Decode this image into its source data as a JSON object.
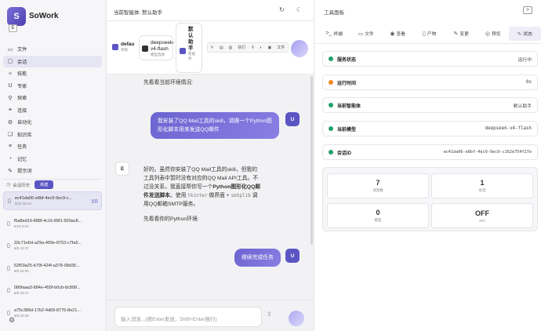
{
  "app": {
    "logo": "S",
    "name": "SoWork",
    "collapse_icon": "E"
  },
  "nav": [
    {
      "icon": "folder-icon",
      "glyph": "▭",
      "label": "文件"
    },
    {
      "icon": "chat-icon",
      "glyph": "▢",
      "label": "会话",
      "active": true
    },
    {
      "icon": "skill-icon",
      "glyph": "✧",
      "label": "技能"
    },
    {
      "icon": "expert-icon",
      "glyph": "U",
      "label": "专家"
    },
    {
      "icon": "explore-icon",
      "glyph": "⚲",
      "label": "探索"
    },
    {
      "icon": "connect-icon",
      "glyph": "⚭",
      "label": "连接"
    },
    {
      "icon": "automation-icon",
      "glyph": "⚙",
      "label": "自动化"
    },
    {
      "icon": "knowledge-icon",
      "glyph": "❏",
      "label": "知识库"
    },
    {
      "icon": "task-icon",
      "glyph": "≡",
      "label": "任务"
    },
    {
      "icon": "memory-icon",
      "glyph": "◔",
      "label": "记忆"
    },
    {
      "icon": "prompt-icon",
      "glyph": "✎",
      "label": "提示词"
    }
  ],
  "history": {
    "label": "会话历史",
    "new_label": "新建",
    "current_tag": "当前",
    "items": [
      {
        "id": "ec41da06-e8bf-4ec9-9ec9-c...",
        "date": "5/10 16:14",
        "active": true
      },
      {
        "id": "f5a8ed19-888f-4c16-89f1-500ac8...",
        "date": "5/10 0:03"
      },
      {
        "id": "33c71e6d-a29a-469e-8753-c7fa5...",
        "date": "5/9 23:37"
      },
      {
        "id": "52f03a25-b79f-424f-a378-08d35...",
        "date": "5/9 22:50"
      },
      {
        "id": "080faaa3-884e-455f-b0cb-8c808...",
        "date": "5/9 22:27"
      },
      {
        "id": "a75c389d-17b2-4d69-8776-8e21...",
        "date": "5/9 22:26"
      }
    ]
  },
  "header": {
    "title": "当前智能体: 默认助手"
  },
  "agents": {
    "chip1_main": "defau",
    "chip1_sub": "项目",
    "chip2_main": "deepseek-v4-flash",
    "chip2_sub": "模型选择",
    "chip3_main": "默认助手",
    "chip3_sub": "智能体",
    "tools": [
      "✎",
      "▤",
      "▥",
      "执行",
      "⚲",
      "◐",
      "▣",
      "文件"
    ]
  },
  "chat": {
    "m0": "先看看当前环境情况:",
    "user1": "我安装了QQ Mail工具的skill，请做一个Python图形化脚本用来发送QQ邮件",
    "user_avatar": "U",
    "bot_avatar": "E",
    "bot_a": "好的。虽然你安装了QQ Mail工具的skill，但我的工具列表中暂时没有对应的QQ Mail API工具。不过没关系，我直接帮你写一个",
    "bot_bold": "Python图形化QQ邮件发送脚本",
    "bot_b": "。使用",
    "code1": "tkinter",
    "bot_c": "做界面 +",
    "code2": "smtplib",
    "bot_d": "调用QQ邮箱SMTP服务。",
    "m2": "先看看你的Python环境:",
    "user2": "继续完成任务"
  },
  "input": {
    "placeholder": "输入消息...(按Enter发送，Shift+Enter换行)"
  },
  "panel": {
    "title": "工具面板",
    "close_glyph": ">",
    "tabs": [
      {
        "icon": "terminal-icon",
        "glyph": ">_",
        "label": "终端"
      },
      {
        "icon": "file-icon",
        "glyph": "▭",
        "label": "文件"
      },
      {
        "icon": "view-icon",
        "glyph": "◉",
        "label": "查看"
      },
      {
        "icon": "artifact-icon",
        "glyph": "▯",
        "label": "产物"
      },
      {
        "icon": "change-icon",
        "glyph": "✎",
        "label": "变更"
      },
      {
        "icon": "preview-icon",
        "glyph": "◎",
        "label": "预览"
      },
      {
        "icon": "status-icon",
        "glyph": "∿",
        "label": "状态",
        "active": true
      }
    ],
    "rows": [
      {
        "label": "服务状态",
        "value": "运行中",
        "dot": "#22a06b"
      },
      {
        "label": "运行时间",
        "value": "0s",
        "dot": "#f08a24"
      },
      {
        "label": "当前智能体",
        "value": "默认助手",
        "dot": "#22a06b"
      },
      {
        "label": "当前模型",
        "value": "deepseek-v4-flash",
        "dot": "#22a06b"
      },
      {
        "label": "会话ID",
        "value": "ec41da06-e8bf-4ec9-9ec9-c162e754f27e",
        "dot": "#22a06b"
      }
    ],
    "stats": [
      {
        "value": "7",
        "label": "消息数"
      },
      {
        "value": "1",
        "label": "会话"
      },
      {
        "value": "0",
        "label": "模型"
      },
      {
        "value": "OFF",
        "label": "KPI"
      }
    ]
  }
}
